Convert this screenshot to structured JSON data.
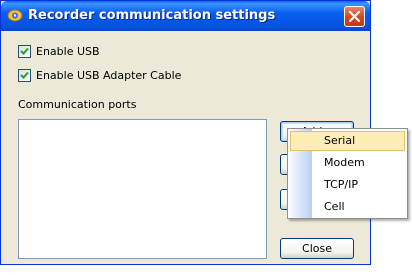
{
  "window": {
    "title": "Recorder communication settings"
  },
  "options": {
    "enable_usb": {
      "label": "Enable USB",
      "checked": true
    },
    "enable_usb_adapter": {
      "label": "Enable USB Adapter Cable",
      "checked": true
    }
  },
  "ports": {
    "label": "Communication ports",
    "items": []
  },
  "buttons": {
    "add_label": "Add...",
    "close_label": "Close"
  },
  "menu": {
    "items": [
      "Serial",
      "Modem",
      "TCP/IP",
      "Cell"
    ],
    "highlighted": "Serial"
  },
  "colors": {
    "titlebar": "#0a5df0",
    "dialog_bg": "#ece9d8",
    "menu_highlight": "#ffedb6"
  },
  "icons": [
    "app-icon",
    "close-icon",
    "checkmark-icon"
  ]
}
